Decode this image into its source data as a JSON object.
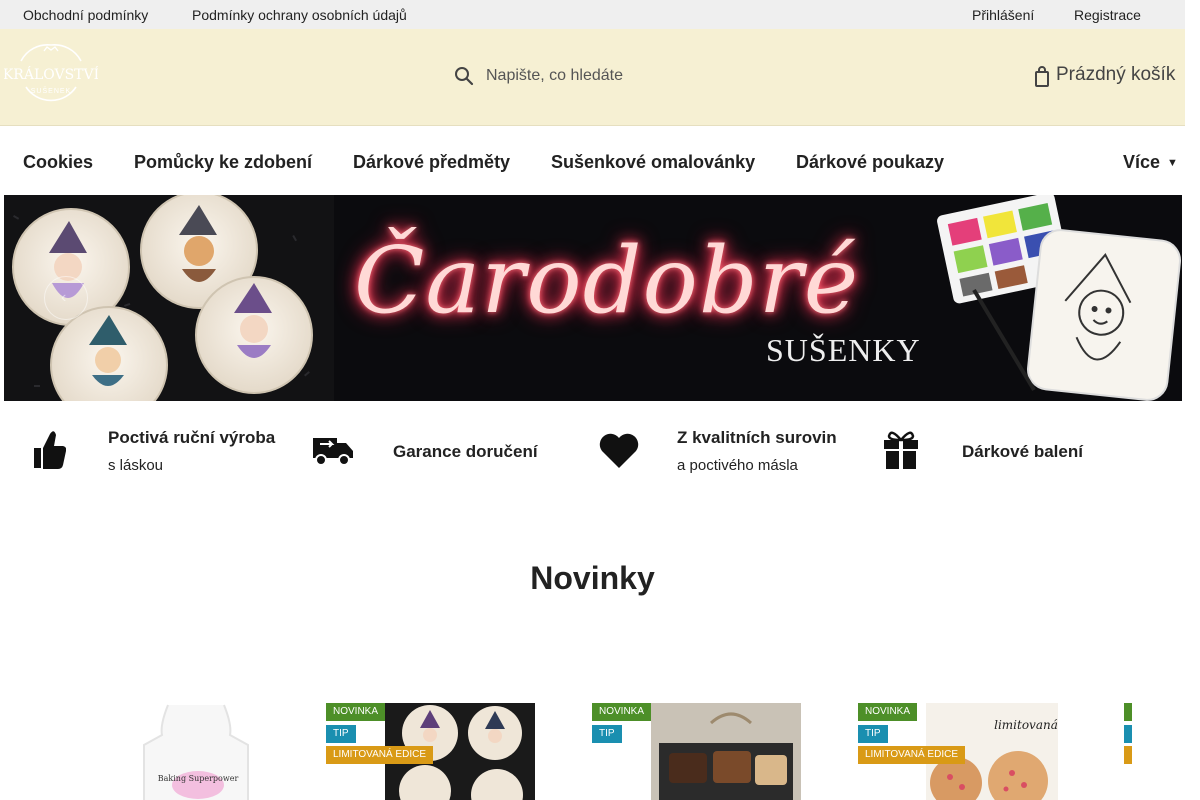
{
  "topbar": {
    "links": [
      "Obchodní podmínky",
      "Podmínky ochrany osobních údajů"
    ],
    "login": "Přihlášení",
    "register": "Registrace"
  },
  "header": {
    "logo_text": "KRÁLOVSTVÍ",
    "logo_sub": "SUŠENEK",
    "search_placeholder": "Napište, co hledáte",
    "cart_label": "Prázdný košík"
  },
  "nav": {
    "items": [
      "Cookies",
      "Pomůcky ke zdobení",
      "Dárkové předměty",
      "Sušenkové omalovánky",
      "Dárkové poukazy"
    ],
    "more": "Více"
  },
  "banner": {
    "title": "Čarodobré",
    "subtitle": "SUŠENKY"
  },
  "features": [
    {
      "icon": "thumbs-up-icon",
      "title": "Poctivá ruční výroba",
      "sub": "s láskou"
    },
    {
      "icon": "delivery-truck-icon",
      "title": "Garance doručení",
      "sub": ""
    },
    {
      "icon": "heart-icon",
      "title": "Z kvalitních surovin",
      "sub": "a poctivého másla"
    },
    {
      "icon": "gift-icon",
      "title": "Dárkové balení",
      "sub": ""
    }
  ],
  "section": {
    "title": "Novinky"
  },
  "badges": {
    "new": "NOVINKA",
    "tip": "TIP",
    "limited": "LIMITOVANÁ EDICE"
  },
  "products_overlay": {
    "limited_logo": "limitovaná",
    "apron_text": "Baking Superpower"
  },
  "colors": {
    "header_bg": "#f6f0d3",
    "topbar_bg": "#efefef",
    "badge_new": "#4d8f28",
    "badge_tip": "#1a8fb0",
    "badge_limited": "#d99a16",
    "neon": "#ff3a55"
  }
}
